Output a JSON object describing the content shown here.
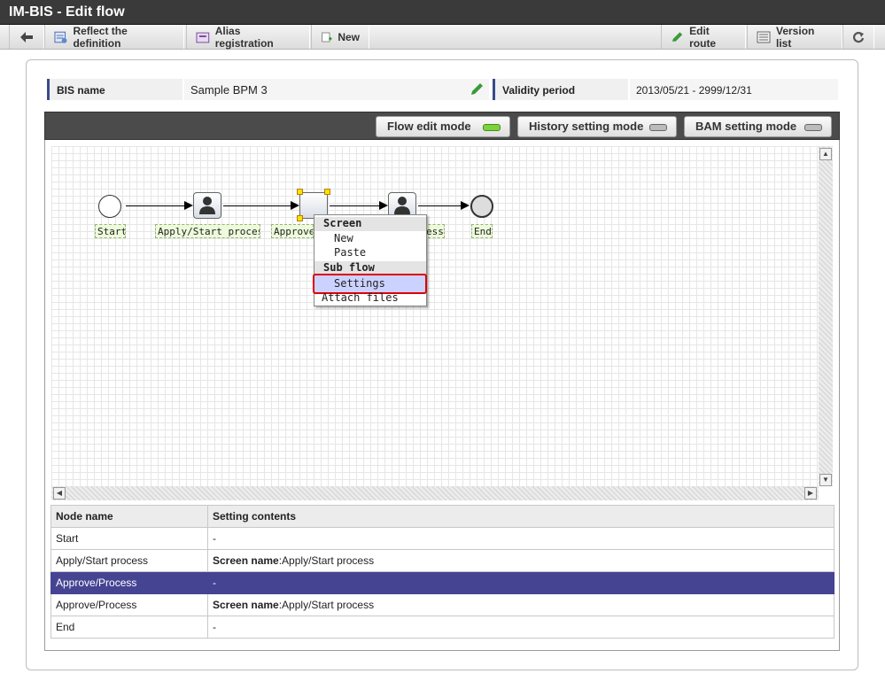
{
  "window": {
    "title": "IM-BIS - Edit flow"
  },
  "toolbar": {
    "back_icon": "arrow-left-icon",
    "reflect": "Reflect the definition",
    "alias": "Alias registration",
    "new": "New",
    "edit_route": "Edit route",
    "version_list": "Version list",
    "refresh_icon": "refresh-icon"
  },
  "info": {
    "bis_name_label": "BIS name",
    "bis_name_value": "Sample BPM 3",
    "validity_label": "Validity period",
    "validity_value": "2013/05/21  -  2999/12/31"
  },
  "modes": [
    {
      "label": "Flow edit mode",
      "active": true
    },
    {
      "label": "History setting mode",
      "active": false
    },
    {
      "label": "BAM setting mode",
      "active": false
    }
  ],
  "flow": {
    "nodes": [
      "Start",
      "Apply/Start process",
      "Approve",
      "ess",
      "End"
    ]
  },
  "context_menu": {
    "h1": "Screen",
    "i1": "New",
    "i2": "Paste",
    "h2": "Sub flow",
    "i3": "Settings",
    "i4": "Attach files"
  },
  "table": {
    "col1": "Node name",
    "col2": "Setting contents",
    "rows": [
      {
        "name": "Start",
        "key": "",
        "value": "-"
      },
      {
        "name": "Apply/Start process",
        "key": "Screen name",
        "value": ":Apply/Start process"
      },
      {
        "name": "Approve/Process",
        "key": "",
        "value": "-"
      },
      {
        "name": "Approve/Process",
        "key": "Screen name",
        "value": ":Apply/Start process"
      },
      {
        "name": "End",
        "key": "",
        "value": "-"
      }
    ]
  },
  "colors": {
    "accent": "#454493",
    "active_led": "#7cd23a",
    "highlight_border": "#dd0000"
  }
}
